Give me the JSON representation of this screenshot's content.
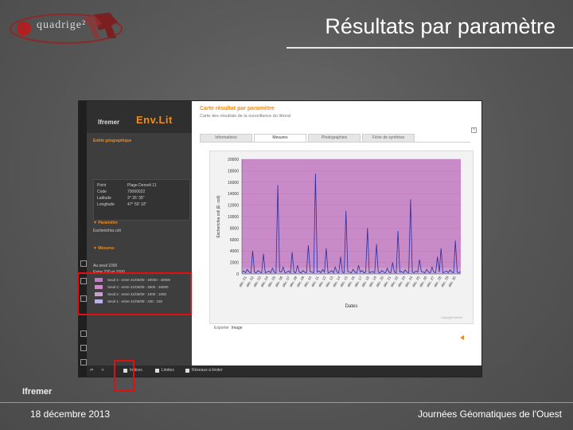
{
  "slide": {
    "logo_text": "quadrige²",
    "title": "Résultats par paramètre",
    "footer_left": "18 décembre 2013",
    "footer_right": "Journées Géomatiques de l'Ouest",
    "footer_logo": "Ifremer"
  },
  "app": {
    "brand": "Ifremer",
    "product": "Env.Lit",
    "section_geo": "Entité géographique",
    "info": [
      {
        "k": "Point",
        "v": "Plage Denoël 11"
      },
      {
        "k": "Code",
        "v": "70060022"
      },
      {
        "k": "Latitude",
        "v": "3° 35' 35\""
      },
      {
        "k": "Longitude",
        "v": "47° 50' 10\""
      }
    ],
    "section_param": "▼ Paramètre",
    "param_value": "Escherichia coli",
    "section_mesures": "▼ Mesures",
    "mesures_lines": [
      "Au seuil 1000",
      "Entre 230 et 1000"
    ],
    "legend": [
      {
        "label": "Seuil 4 : entre 21/05/09 : 40000 : 40000",
        "color": "#c878c8"
      },
      {
        "label": "Seuil 3 : entre 21/05/09 : 4600 : 46000",
        "color": "#d08ac8"
      },
      {
        "label": "Seuil 2 : entre 21/05/09 : 1000 : 1000",
        "color": "#c9a0d0"
      },
      {
        "label": "Seuil 1 : entre 21/05/09 : 230 : 230",
        "color": "#b9b0e8"
      }
    ],
    "rp_title": "Carte résultat par paramètre",
    "rp_subtitle": "Carte des résultats de la surveillance du littoral",
    "tabs": [
      "Informations",
      "Mesures",
      "Photographies",
      "Fiche de synthèse"
    ],
    "active_tab": 1,
    "exporter": "Exporter",
    "exporter_format": "Image",
    "copyright": "Copyright Ifremer",
    "bottom_checks": [
      "Indices",
      "Limites",
      "Réseaux à limiter"
    ],
    "colors": {
      "accent": "#f08c1e",
      "highlight": "#e01010"
    }
  },
  "chart_data": {
    "type": "line",
    "title": "",
    "xlabel": "Dates",
    "ylabel": "Escherichia coli (E. coli)",
    "ylim": [
      0,
      20000
    ],
    "yticks": [
      0,
      2000,
      4000,
      6000,
      8000,
      10000,
      12000,
      14000,
      16000,
      18000,
      20000
    ],
    "xticks": [
      "déc. 01",
      "déc. 02",
      "déc. 03",
      "déc. 04",
      "déc. 05",
      "déc. 06",
      "déc. 07",
      "déc. 08",
      "déc. 09",
      "déc. 10",
      "déc. 11",
      "déc. 12",
      "déc. 13",
      "déc. 14",
      "déc. 15",
      "déc. 16",
      "déc. 17",
      "déc. 18",
      "déc. 19",
      "déc. 20",
      "déc. 21",
      "déc. 22",
      "déc. 23",
      "déc. 24",
      "déc. 25",
      "déc. 26",
      "déc. 27",
      "déc. 28",
      "déc. 29",
      "déc. 30"
    ],
    "bands": [
      {
        "from": 0,
        "to": 230,
        "color": "#b9b0e8"
      },
      {
        "from": 230,
        "to": 1000,
        "color": "#c9a0d0"
      },
      {
        "from": 1000,
        "to": 20000,
        "color": "#c98ac8"
      }
    ],
    "series": [
      {
        "color": "#2b2f9e",
        "values": [
          300,
          500,
          200,
          800,
          300,
          200,
          4000,
          300,
          200,
          600,
          300,
          200,
          3500,
          200,
          300,
          500,
          200,
          1000,
          300,
          200,
          15500,
          400,
          300,
          1200,
          200,
          300,
          500,
          200,
          3800,
          300,
          200,
          1500,
          300,
          200,
          600,
          300,
          200,
          5000,
          400,
          300,
          200,
          17500,
          300,
          500,
          200,
          800,
          300,
          4500,
          200,
          300,
          600,
          200,
          1200,
          300,
          200,
          3000,
          300,
          200,
          11000,
          400,
          300,
          200,
          800,
          300,
          200,
          1500,
          300,
          600,
          200,
          300,
          8000,
          200,
          300,
          400,
          200,
          5200,
          300,
          200,
          600,
          300,
          200,
          1000,
          300,
          200,
          2000,
          300,
          200,
          7500,
          300,
          400,
          200,
          700,
          300,
          200,
          13000,
          300,
          200,
          500,
          300,
          2500,
          400,
          300,
          200,
          800,
          300,
          200,
          1200,
          300,
          200,
          3000,
          300,
          4500,
          200,
          300,
          500,
          200,
          700,
          300,
          200,
          5800,
          300,
          200,
          400
        ]
      }
    ]
  }
}
